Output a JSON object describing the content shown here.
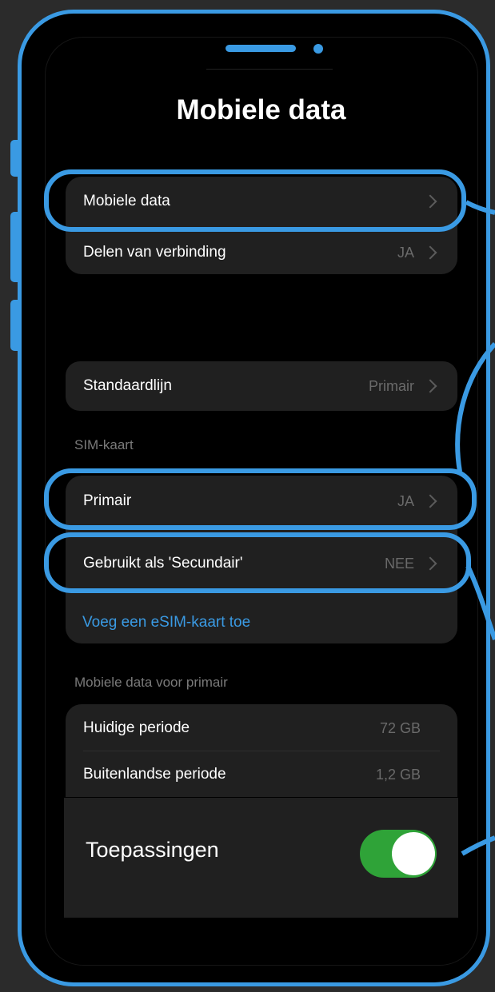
{
  "header": {
    "title": "Mobiele data"
  },
  "main_rows": [
    {
      "label": "Mobiele data",
      "value": ""
    },
    {
      "label": "Delen van verbinding",
      "value": "JA"
    }
  ],
  "default_line": {
    "label": "Standaardlijn",
    "value": "Primair"
  },
  "sim": {
    "section_label": "SIM-kaart",
    "rows": [
      {
        "label": "Primair",
        "value": "JA"
      },
      {
        "label": "Gebruikt als 'Secundair'",
        "value": "NEE"
      }
    ],
    "add_esim": "Voeg een eSIM-kaart toe"
  },
  "usage": {
    "section_label": "Mobiele data voor primair",
    "rows": [
      {
        "label": "Huidige periode",
        "value": "72 GB"
      },
      {
        "label": "Buitenlandse periode",
        "value": "1,2 GB"
      }
    ]
  },
  "apps": {
    "label": "Toepassingen",
    "toggle_on": true
  },
  "colors": {
    "accent": "#3a9ae3",
    "toggle_on": "#2fa338",
    "card": "#202020"
  }
}
